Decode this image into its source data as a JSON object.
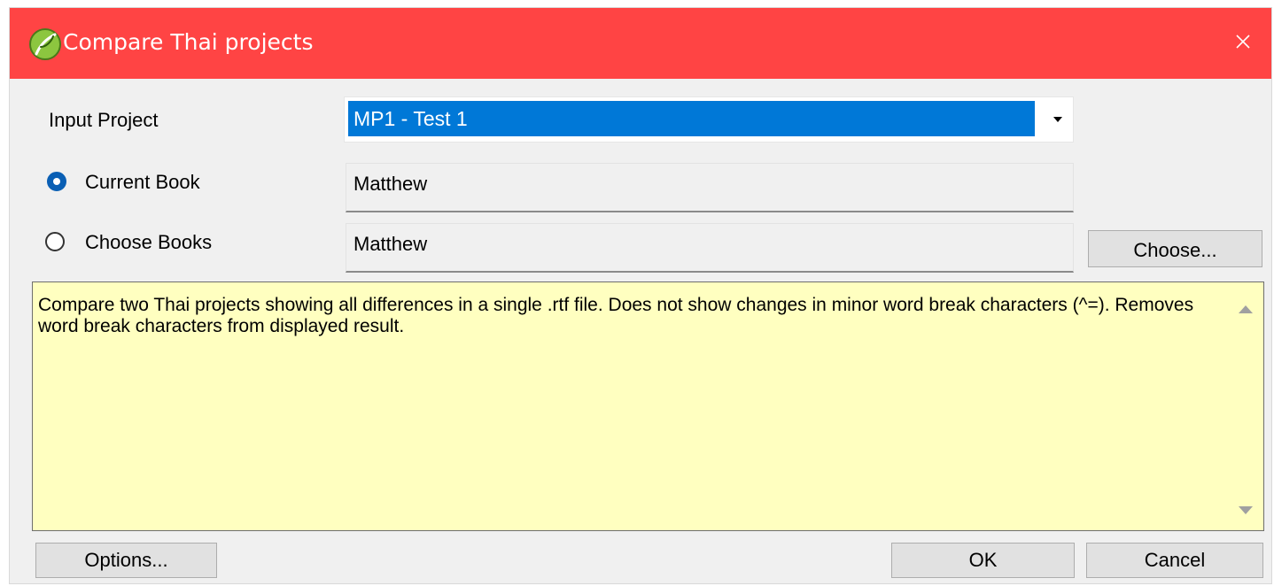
{
  "window": {
    "title": "Compare Thai projects",
    "titlebar_color": "#ff4444"
  },
  "form": {
    "input_project_label": "Input Project",
    "input_project_value": "MP1 -  Test 1",
    "current_book_label": "Current Book",
    "current_book_value": "Matthew",
    "current_book_selected": true,
    "choose_books_label": "Choose Books",
    "choose_books_value": "Matthew",
    "choose_books_selected": false,
    "choose_button_label": "Choose..."
  },
  "description": {
    "text": "Compare two Thai projects showing all differences in a single .rtf file. Does not show changes in minor word break characters (^=). Removes word break characters from displayed result.",
    "background": "#ffffc0"
  },
  "footer": {
    "options_label": "Options...",
    "ok_label": "OK",
    "cancel_label": "Cancel"
  },
  "icons": {
    "app": "leaf-app-icon",
    "close": "close-icon",
    "dropdown": "chevron-down-icon",
    "scroll_up": "scroll-up-arrow",
    "scroll_down": "scroll-down-arrow"
  }
}
